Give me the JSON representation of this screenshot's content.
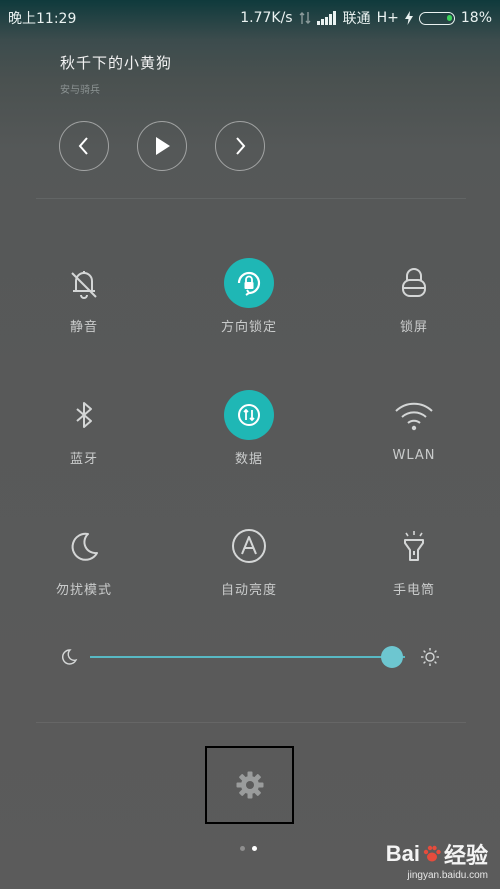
{
  "status_bar": {
    "time": "晚上11:29",
    "speed": "1.77K/s",
    "carrier": "联通",
    "network": "H+",
    "battery": "18%",
    "battery_level": 0.18
  },
  "music": {
    "title": "秋千下的小黄狗",
    "artist": "安与骑兵"
  },
  "toggles": {
    "mute": {
      "label": "静音",
      "active": false,
      "icon": "bell-off-icon"
    },
    "rotation_lock": {
      "label": "方向锁定",
      "active": true,
      "icon": "rotation-lock-icon"
    },
    "lock_screen": {
      "label": "锁屏",
      "active": false,
      "icon": "lock-icon"
    },
    "bluetooth": {
      "label": "蓝牙",
      "active": false,
      "icon": "bluetooth-icon"
    },
    "data": {
      "label": "数据",
      "active": true,
      "icon": "mobile-data-icon"
    },
    "wlan": {
      "label": "WLAN",
      "active": false,
      "icon": "wifi-icon"
    },
    "dnd": {
      "label": "勿扰模式",
      "active": false,
      "icon": "moon-icon"
    },
    "auto_brightness": {
      "label": "自动亮度",
      "active": false,
      "icon": "auto-brightness-icon"
    },
    "flashlight": {
      "label": "手电筒",
      "active": false,
      "icon": "flashlight-icon"
    }
  },
  "brightness": {
    "value": 0.96
  },
  "pager": {
    "current": 2,
    "total": 2
  },
  "colors": {
    "accent": "#1fb7b5",
    "slider": "#58b9c4",
    "battery": "#3cd35d"
  },
  "watermark": {
    "brand_left": "Bai",
    "brand_right": "经验",
    "url": "jingyan.baidu.com"
  }
}
